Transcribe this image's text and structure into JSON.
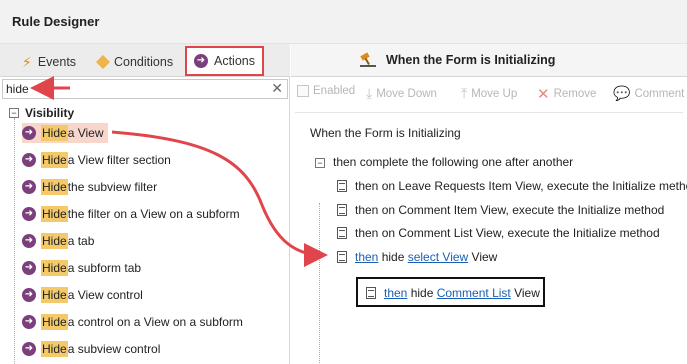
{
  "window": {
    "title": "Rule Designer"
  },
  "tabs": [
    {
      "label": "Events",
      "icon": "lightning-icon"
    },
    {
      "label": "Conditions",
      "icon": "diamond-icon"
    },
    {
      "label": "Actions",
      "icon": "arrow-circle-icon",
      "active": true
    }
  ],
  "search": {
    "value": "hide",
    "clear_icon": "close-icon"
  },
  "tree": {
    "group": "Visibility",
    "items": [
      {
        "match": "Hide",
        "rest": " a View"
      },
      {
        "match": "Hide",
        "rest": " a View filter section"
      },
      {
        "match": "Hide",
        "rest": " the subview filter"
      },
      {
        "match": "Hide",
        "rest": " the filter on a View on a subform"
      },
      {
        "match": "Hide",
        "rest": " a tab"
      },
      {
        "match": "Hide",
        "rest": " a subform tab"
      },
      {
        "match": "Hide",
        "rest": " a View control"
      },
      {
        "match": "Hide",
        "rest": " a control on a View on a subform"
      },
      {
        "match": "Hide",
        "rest": " a subview control"
      }
    ]
  },
  "editor": {
    "title": "When the Form is Initializing",
    "toolbar": {
      "enabled": "Enabled",
      "move_down": "Move Down",
      "move_up": "Move Up",
      "remove": "Remove",
      "comment": "Comment"
    },
    "event": "When the Form is Initializing",
    "block": "then complete the following one after another",
    "lines": [
      {
        "pre": "then on ",
        "obj": "Leave Requests Item View",
        "post": ", execute the Initialize method"
      },
      {
        "pre": "then on ",
        "obj": "Comment Item View",
        "post": ", execute the Initialize method"
      },
      {
        "pre": "then on ",
        "obj": "Comment List View",
        "post": ", execute the Initialize method"
      }
    ],
    "new_rule": {
      "then": "then",
      "verb": " hide ",
      "target": "select View",
      "tail": " View"
    }
  },
  "callout": {
    "then": "then",
    "verb": " hide ",
    "target": "Comment List",
    "tail": " View"
  },
  "colors": {
    "accent": "#e0454b",
    "highlight": "#f4c96a",
    "link": "#1a5fb4",
    "action_icon": "#7b3f7c"
  }
}
